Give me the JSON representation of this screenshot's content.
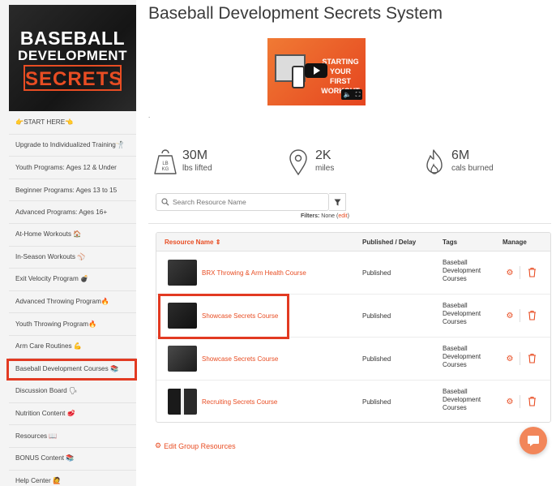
{
  "logo": {
    "line1": "BASEBALL",
    "line2": "DEVELOPMENT",
    "line3": "SECRETS"
  },
  "sidebar": {
    "items": [
      {
        "label": "👉START HERE👈"
      },
      {
        "label": "Upgrade to Individualized Training🤺"
      },
      {
        "label": "Youth Programs: Ages 12 & Under"
      },
      {
        "label": "Beginner Programs: Ages 13 to 15"
      },
      {
        "label": "Advanced Programs: Ages 16+"
      },
      {
        "label": "At-Home Workouts 🏠"
      },
      {
        "label": "In-Season Workouts ⚾"
      },
      {
        "label": "Exit Velocity Program 💣"
      },
      {
        "label": "Advanced Throwing Program🔥"
      },
      {
        "label": "Youth Throwing Program🔥"
      },
      {
        "label": "Arm Care Routines 💪"
      },
      {
        "label": "Baseball Development Courses 📚"
      },
      {
        "label": "Discussion Board 🗣"
      },
      {
        "label": "Nutrition Content 🥩"
      },
      {
        "label": "Resources 📖"
      },
      {
        "label": "BONUS Content 📚"
      },
      {
        "label": "Help Center 🙋"
      }
    ],
    "active_index": 11
  },
  "page": {
    "title": "Baseball Development Secrets System",
    "dot": "."
  },
  "video": {
    "text": "STARTING YOUR FIRST WORKOUT"
  },
  "stats": [
    {
      "value": "30M",
      "label": "lbs lifted",
      "icon": "weight-icon",
      "icon_text": "LB\nKG"
    },
    {
      "value": "2K",
      "label": "miles",
      "icon": "location-pin-icon"
    },
    {
      "value": "6M",
      "label": "cals burned",
      "icon": "flame-icon"
    }
  ],
  "search": {
    "placeholder": "Search Resource Name"
  },
  "filters": {
    "label": "Filters:",
    "value": "None",
    "edit": "edit"
  },
  "table": {
    "headers": {
      "name": "Resource Name ⇕",
      "status": "Published / Delay",
      "tags": "Tags",
      "manage": "Manage"
    },
    "rows": [
      {
        "name": "BRX Throwing & Arm Health Course",
        "status": "Published",
        "tags": [
          "Baseball",
          "Development",
          "Courses"
        ]
      },
      {
        "name": "Showcase Secrets Course",
        "status": "Published",
        "tags": [
          "Baseball",
          "Development",
          "Courses"
        ]
      },
      {
        "name": "Showcase Secrets Course",
        "status": "Published",
        "tags": [
          "Baseball",
          "Development",
          "Courses"
        ]
      },
      {
        "name": "Recruiting Secrets Course",
        "status": "Published",
        "tags": [
          "Baseball",
          "Development",
          "Courses"
        ]
      }
    ]
  },
  "edit_group": {
    "label": "Edit Group Resources"
  },
  "colors": {
    "accent": "#e84d23",
    "highlight": "#e23a22",
    "chat": "#f2865a"
  }
}
